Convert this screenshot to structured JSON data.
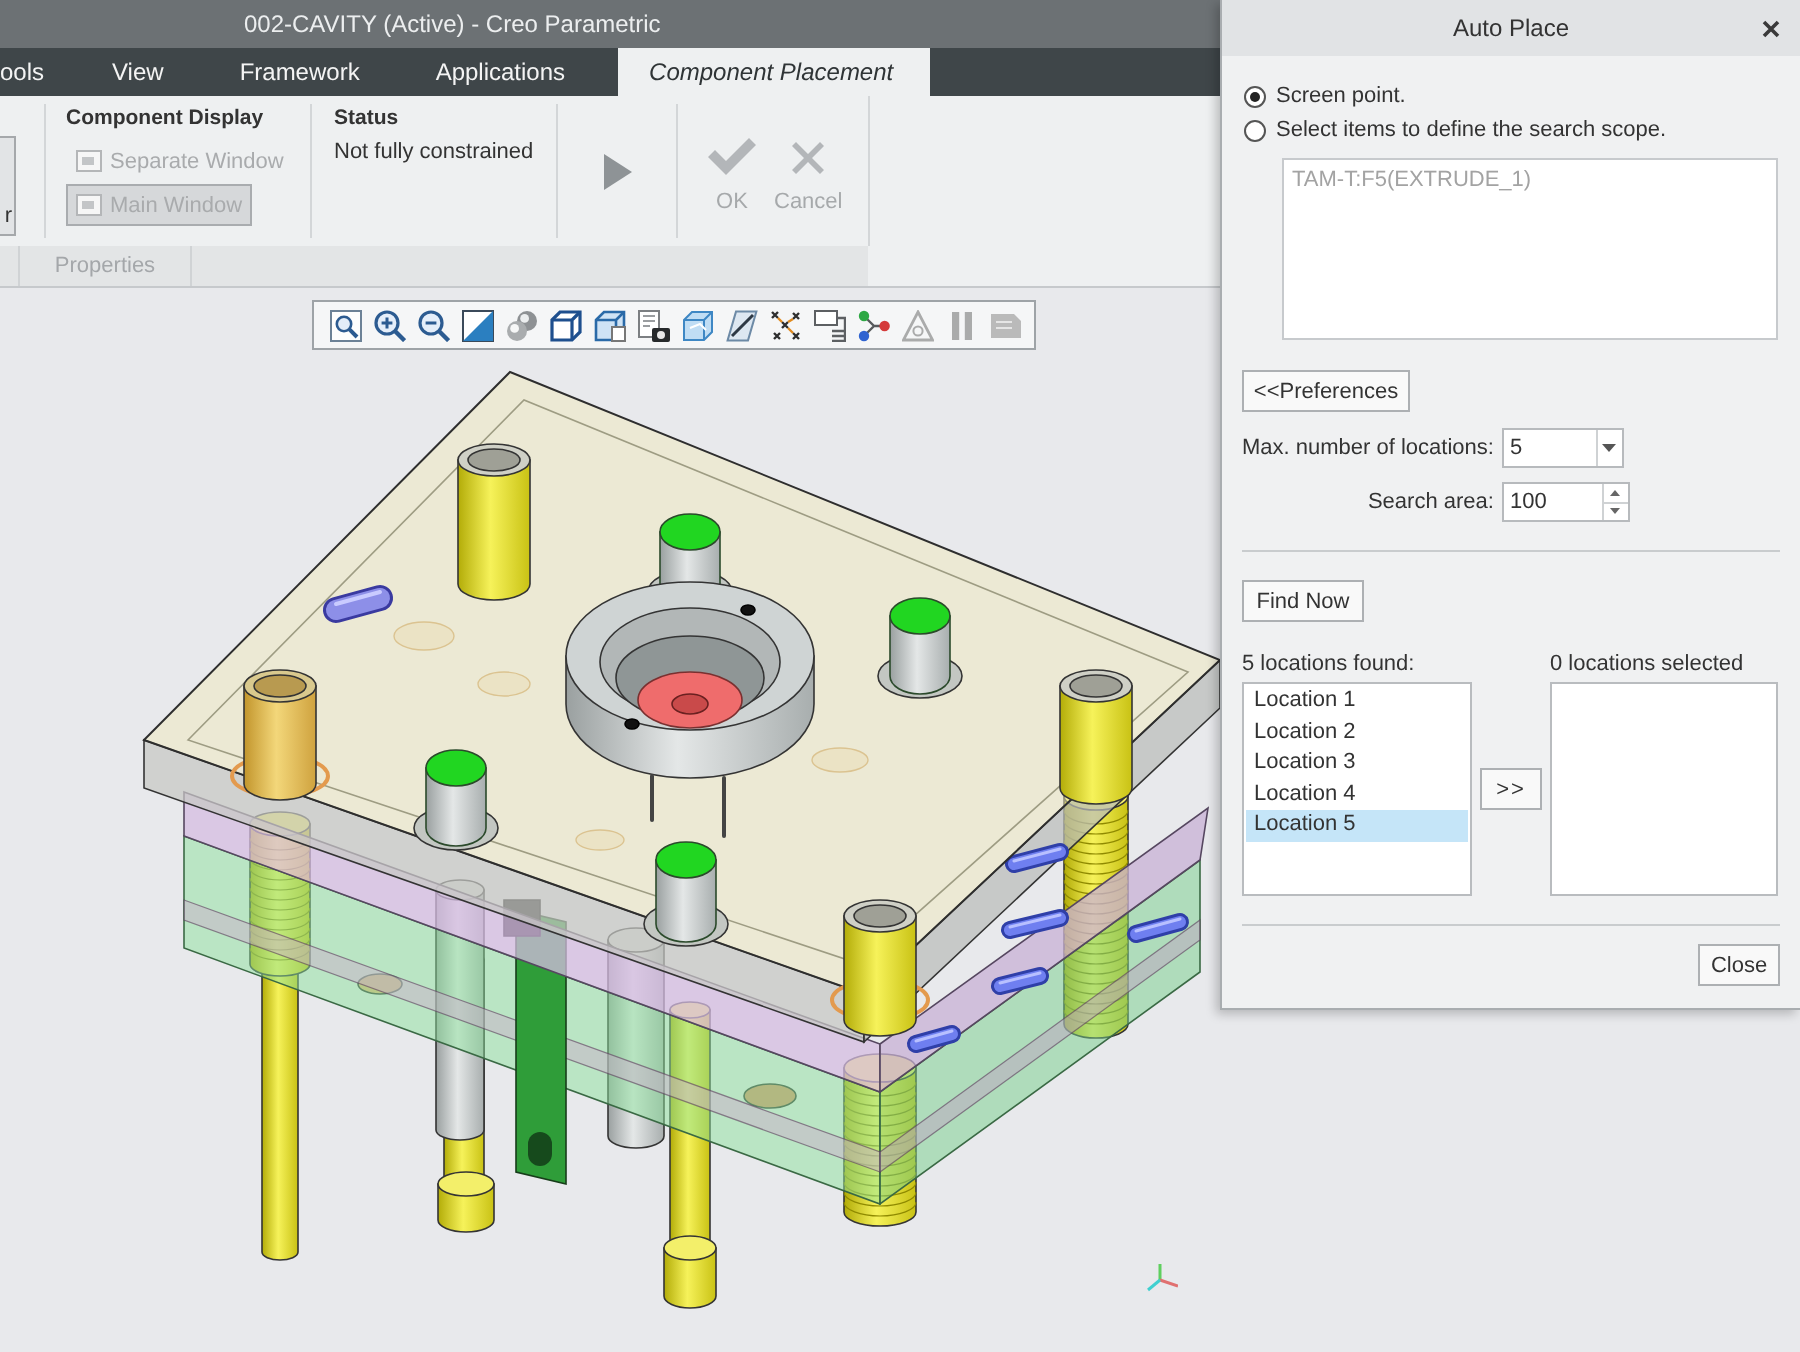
{
  "window": {
    "title": "002-CAVITY (Active) - Creo Parametric"
  },
  "tabs": [
    {
      "label": "ools",
      "selected": false
    },
    {
      "label": "View",
      "selected": false
    },
    {
      "label": "Framework",
      "selected": false
    },
    {
      "label": "Applications",
      "selected": false
    },
    {
      "label": "Component Placement",
      "selected": true
    }
  ],
  "ribbon": {
    "cut_button": {
      "label": "r"
    },
    "component_display": {
      "title": "Component Display",
      "buttons": [
        {
          "label": "Separate Window",
          "selected": false,
          "disabled": true
        },
        {
          "label": "Main Window",
          "selected": true,
          "disabled": true
        }
      ]
    },
    "status": {
      "title": "Status",
      "text": "Not fully constrained"
    },
    "actions": [
      {
        "kind": "check",
        "label": "OK",
        "disabled": true
      },
      {
        "kind": "cross",
        "label": "Cancel",
        "disabled": true
      }
    ],
    "panel_tabs": [
      {
        "label": "Properties",
        "disabled": true
      }
    ]
  },
  "view_toolbar": {
    "buttons": [
      {
        "kind": "magnifier",
        "disabled": false
      },
      {
        "kind": "zoom_in",
        "disabled": false
      },
      {
        "kind": "zoom_out",
        "disabled": false
      },
      {
        "kind": "split_square",
        "disabled": false
      },
      {
        "kind": "spheres",
        "disabled": false
      },
      {
        "kind": "cube",
        "disabled": false
      },
      {
        "kind": "cube_doc",
        "disabled": false
      },
      {
        "kind": "sheet_camera",
        "disabled": false
      },
      {
        "kind": "glass_cube",
        "disabled": false
      },
      {
        "kind": "plane",
        "disabled": false
      },
      {
        "kind": "points",
        "disabled": false
      },
      {
        "kind": "tag",
        "disabled": false
      },
      {
        "kind": "nodes",
        "disabled": false
      },
      {
        "kind": "triangle",
        "disabled": true
      },
      {
        "kind": "pause",
        "disabled": true
      },
      {
        "kind": "panel",
        "disabled": true
      }
    ]
  },
  "dialog": {
    "title": "Auto Place",
    "options": [
      {
        "label": "Screen point.",
        "selected": true
      },
      {
        "label": "Select items to define the search scope.",
        "selected": false
      }
    ],
    "scope": {
      "items": [
        "TAM-T:F5(EXTRUDE_1)"
      ],
      "disabled": true
    },
    "preferences_button": "<<Preferences",
    "max_locations": {
      "label": "Max. number of locations:",
      "value": "5"
    },
    "search_area": {
      "label": "Search area:",
      "value": "100"
    },
    "find_button": "Find Now",
    "found": {
      "label": "5 locations found:",
      "items": [
        {
          "label": "Location 1",
          "selected": false
        },
        {
          "label": "Location 2",
          "selected": false
        },
        {
          "label": "Location 3",
          "selected": false
        },
        {
          "label": "Location 4",
          "selected": false
        },
        {
          "label": "Location 5",
          "selected": true
        }
      ]
    },
    "move_button": ">>",
    "chosen": {
      "label": "0 locations selected"
    },
    "close_button": "Close"
  }
}
